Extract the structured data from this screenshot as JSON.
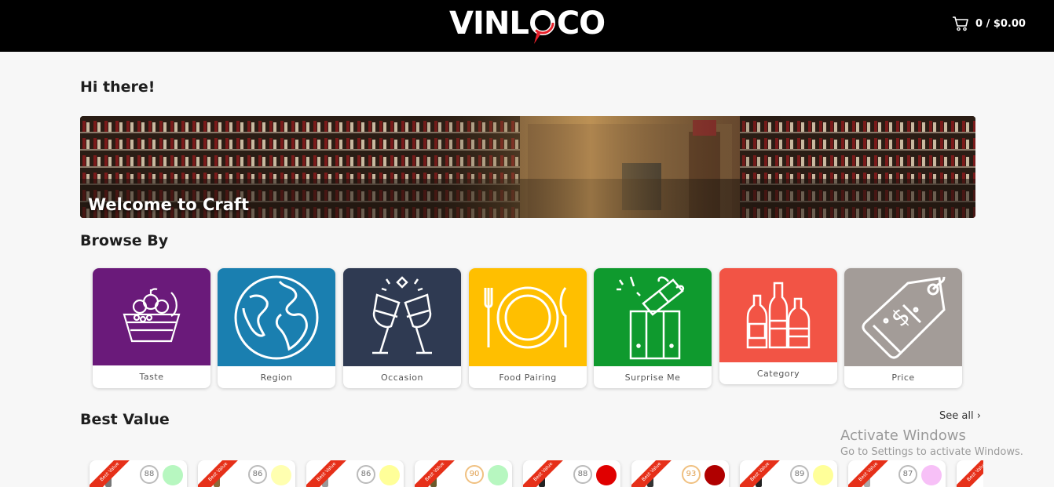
{
  "header": {
    "logo_left": "VINL",
    "logo_right": "CO",
    "cart_text": "0 / $0.00"
  },
  "greeting": "Hi there!",
  "banner": {
    "title": "Welcome to Craft"
  },
  "browse": {
    "title": "Browse By",
    "tiles": [
      {
        "label": "Taste",
        "color": "#6a1a7a",
        "icon": "fruit-basket-icon"
      },
      {
        "label": "Region",
        "color": "#1a7fb0",
        "icon": "globe-icon"
      },
      {
        "label": "Occasion",
        "color": "#2f3a52",
        "icon": "toast-glasses-icon"
      },
      {
        "label": "Food Pairing",
        "color": "#ffbf00",
        "icon": "plate-cutlery-icon"
      },
      {
        "label": "Surprise Me",
        "color": "#0f9a2e",
        "icon": "gift-box-icon"
      },
      {
        "label": "Category",
        "color": "#f25445",
        "icon": "bottles-icon"
      },
      {
        "label": "Price",
        "color": "#a39c98",
        "icon": "price-tag-icon"
      }
    ]
  },
  "best_value": {
    "title": "Best Value",
    "see_all": "See all ›",
    "ribbon": "Best Value",
    "cards": [
      {
        "score": "88",
        "dot_color": "#b7f7c0"
      },
      {
        "score": "86",
        "dot_color": "#ffffb0"
      },
      {
        "score": "86",
        "dot_color": "#ffff99"
      },
      {
        "score": "90",
        "dot_color": "#b7f7c0"
      },
      {
        "score": "88",
        "dot_color": "#e00000"
      },
      {
        "score": "93",
        "dot_color": "#b00000"
      },
      {
        "score": "89",
        "dot_color": "#ffff99"
      },
      {
        "score": "87",
        "dot_color": "#f7c0f7"
      }
    ]
  },
  "watermark": {
    "line1": "Activate Windows",
    "line2": "Go to Settings to activate Windows."
  }
}
